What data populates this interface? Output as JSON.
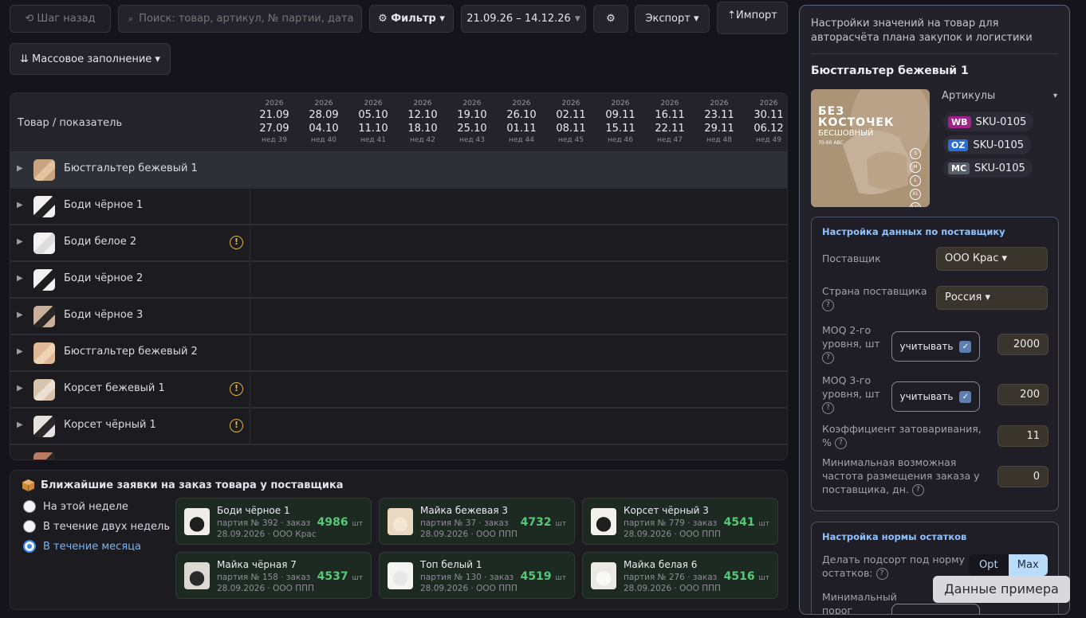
{
  "toolbar": {
    "back_label": "⟲ Шаг назад",
    "search_placeholder": "Поиск: товар, артикул, № партии, дата...",
    "filter_label": "⚙ Фильтр ▾",
    "date_range": "21.09.26 – 14.12.26",
    "settings_glyph": "⚙",
    "export_label": "Экспорт ▾",
    "import_label": "⇡Импорт",
    "bulk_fill_label": "⇊ Массовое заполнение ▾"
  },
  "grid": {
    "column_header": "Товар / показатель",
    "weeks": [
      {
        "year": "2026",
        "from": "21.09",
        "to": "27.09",
        "week": "нед 39"
      },
      {
        "year": "2026",
        "from": "28.09",
        "to": "04.10",
        "week": "нед 40"
      },
      {
        "year": "2026",
        "from": "05.10",
        "to": "11.10",
        "week": "нед 41"
      },
      {
        "year": "2026",
        "from": "12.10",
        "to": "18.10",
        "week": "нед 42"
      },
      {
        "year": "2026",
        "from": "19.10",
        "to": "25.10",
        "week": "нед 43"
      },
      {
        "year": "2026",
        "from": "26.10",
        "to": "01.11",
        "week": "нед 44"
      },
      {
        "year": "2026",
        "from": "02.11",
        "to": "08.11",
        "week": "нед 45"
      },
      {
        "year": "2026",
        "from": "09.11",
        "to": "15.11",
        "week": "нед 46"
      },
      {
        "year": "2026",
        "from": "16.11",
        "to": "22.11",
        "week": "нед 47"
      },
      {
        "year": "2026",
        "from": "23.11",
        "to": "29.11",
        "week": "нед 48"
      },
      {
        "year": "2026",
        "from": "30.11",
        "to": "06.12",
        "week": "нед 49"
      }
    ],
    "rows": [
      {
        "name": "Бюстгальтер бежевый 1",
        "warn": false,
        "selected": true
      },
      {
        "name": "Боди чёрное 1",
        "warn": false
      },
      {
        "name": "Боди белое 2",
        "warn": true
      },
      {
        "name": "Боди чёрное 2",
        "warn": false
      },
      {
        "name": "Боди чёрное 3",
        "warn": false
      },
      {
        "name": "Бюстгальтер бежевый 2",
        "warn": false
      },
      {
        "name": "Корсет бежевый 1",
        "warn": true
      },
      {
        "name": "Корсет чёрный 1",
        "warn": true
      }
    ],
    "expand_glyph": "▶",
    "warn_glyph": "!"
  },
  "orders": {
    "title": "Ближайшие заявки на заказ товара у поставщика",
    "periods": [
      "На этой неделе",
      "В течение двух недель",
      "В течение месяца"
    ],
    "selected_period": "В течение месяца",
    "unit": "шт",
    "cards": [
      {
        "name": "Боди чёрное 1",
        "batch": "партия № 392 · заказ",
        "meta": "28.09.2026 · ООО Крас",
        "qty": "4986"
      },
      {
        "name": "Майка бежевая 3",
        "batch": "партия № 37 · заказ",
        "meta": "28.09.2026 · ООО ППП",
        "qty": "4732"
      },
      {
        "name": "Корсет чёрный 3",
        "batch": "партия № 779 · заказ",
        "meta": "28.09.2026 · ООО ППП",
        "qty": "4541"
      },
      {
        "name": "Майка чёрная 7",
        "batch": "партия № 158 · заказ",
        "meta": "28.09.2026 · ООО ППП",
        "qty": "4537"
      },
      {
        "name": "Топ белый 1",
        "batch": "партия № 130 · заказ",
        "meta": "28.09.2026 · ООО ППП",
        "qty": "4519"
      },
      {
        "name": "Майка белая 6",
        "batch": "партия № 276 · заказ",
        "meta": "28.09.2026 · ООО ППП",
        "qty": "4516"
      }
    ]
  },
  "panel": {
    "header": "Настройки значений на товар для авторасчёта плана закупок и логистики",
    "product_name": "Бюстгальтер бежевый 1",
    "product_image_text": {
      "line1": "БЕЗ",
      "line2": "КОСТОЧЕК",
      "line3": "БЕСШОВНЫЙ",
      "sizes_note": "70-90 ABC",
      "sizes": [
        "S",
        "M",
        "L",
        "XL",
        "XXL"
      ]
    },
    "articles_label": "Артикулы",
    "articles_chevron": "▾",
    "skus": [
      {
        "badge": "WB",
        "code": "SKU-0105",
        "color": "#a0238c"
      },
      {
        "badge": "OZ",
        "code": "SKU-0105",
        "color": "#2b6fd6"
      },
      {
        "badge": "MC",
        "code": "SKU-0105",
        "color": "#5a5e6a"
      }
    ],
    "supplier_section": {
      "title": "Настройка данных по поставщику",
      "supplier_label": "Поставщик",
      "supplier_value": "ООО Крас ▾",
      "country_label": "Страна поставщика",
      "country_value": "Россия ▾",
      "moq2_label": "MOQ 2-го уровня, шт",
      "moq2_toggle": "учитывать",
      "moq2_value": "2000",
      "moq3_label": "MOQ 3-го уровня, шт",
      "moq3_toggle": "учитывать",
      "moq3_value": "200",
      "overstock_label": "Коэффициент затоваривания, %",
      "overstock_value": "11",
      "min_freq_label": "Минимальная возможная частота размещения заказа у поставщика, дн.",
      "min_freq_value": "0",
      "help_glyph": "?",
      "check_glyph": "✓"
    },
    "stock_section": {
      "title": "Настройка нормы остатков",
      "norm_label": "Делать подсорт под норму остатков:",
      "opt_label": "Opt",
      "max_label": "Max",
      "selected": "Max",
      "min_threshold_label": "Минимальный порог"
    }
  },
  "tooltip": "Данные примера"
}
